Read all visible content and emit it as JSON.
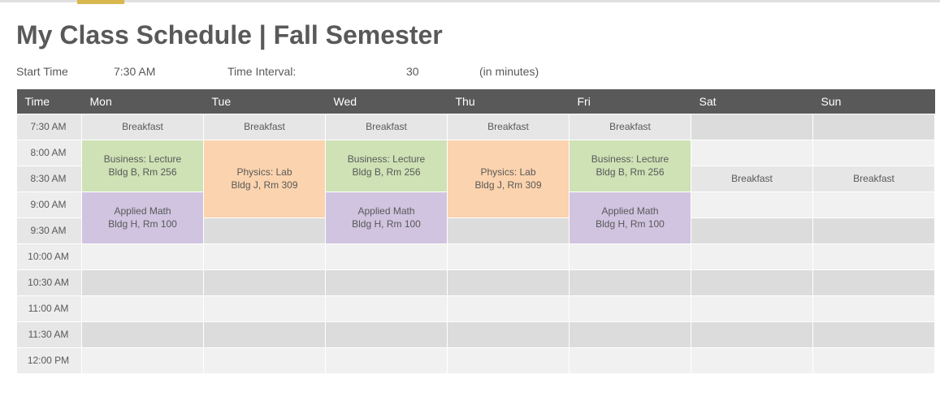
{
  "title": "My Class Schedule | Fall Semester",
  "controls": {
    "start_label": "Start Time",
    "start_value": "7:30 AM",
    "interval_label": "Time Interval:",
    "interval_value": "30",
    "interval_hint": "(in minutes)"
  },
  "headers": {
    "time": "Time",
    "mon": "Mon",
    "tue": "Tue",
    "wed": "Wed",
    "thu": "Thu",
    "fri": "Fri",
    "sat": "Sat",
    "sun": "Sun"
  },
  "times": {
    "t0": "7:30 AM",
    "t1": "8:00 AM",
    "t2": "8:30 AM",
    "t3": "9:00 AM",
    "t4": "9:30 AM",
    "t5": "10:00 AM",
    "t6": "10:30 AM",
    "t7": "11:00 AM",
    "t8": "11:30 AM",
    "t9": "12:00 PM"
  },
  "events": {
    "breakfast": "Breakfast",
    "business": {
      "line1": "Business: Lecture",
      "line2": "Bldg B, Rm 256"
    },
    "physics": {
      "line1": "Physics: Lab",
      "line2": "Bldg J, Rm 309"
    },
    "math": {
      "line1": "Applied Math",
      "line2": "Bldg H, Rm 100"
    }
  }
}
